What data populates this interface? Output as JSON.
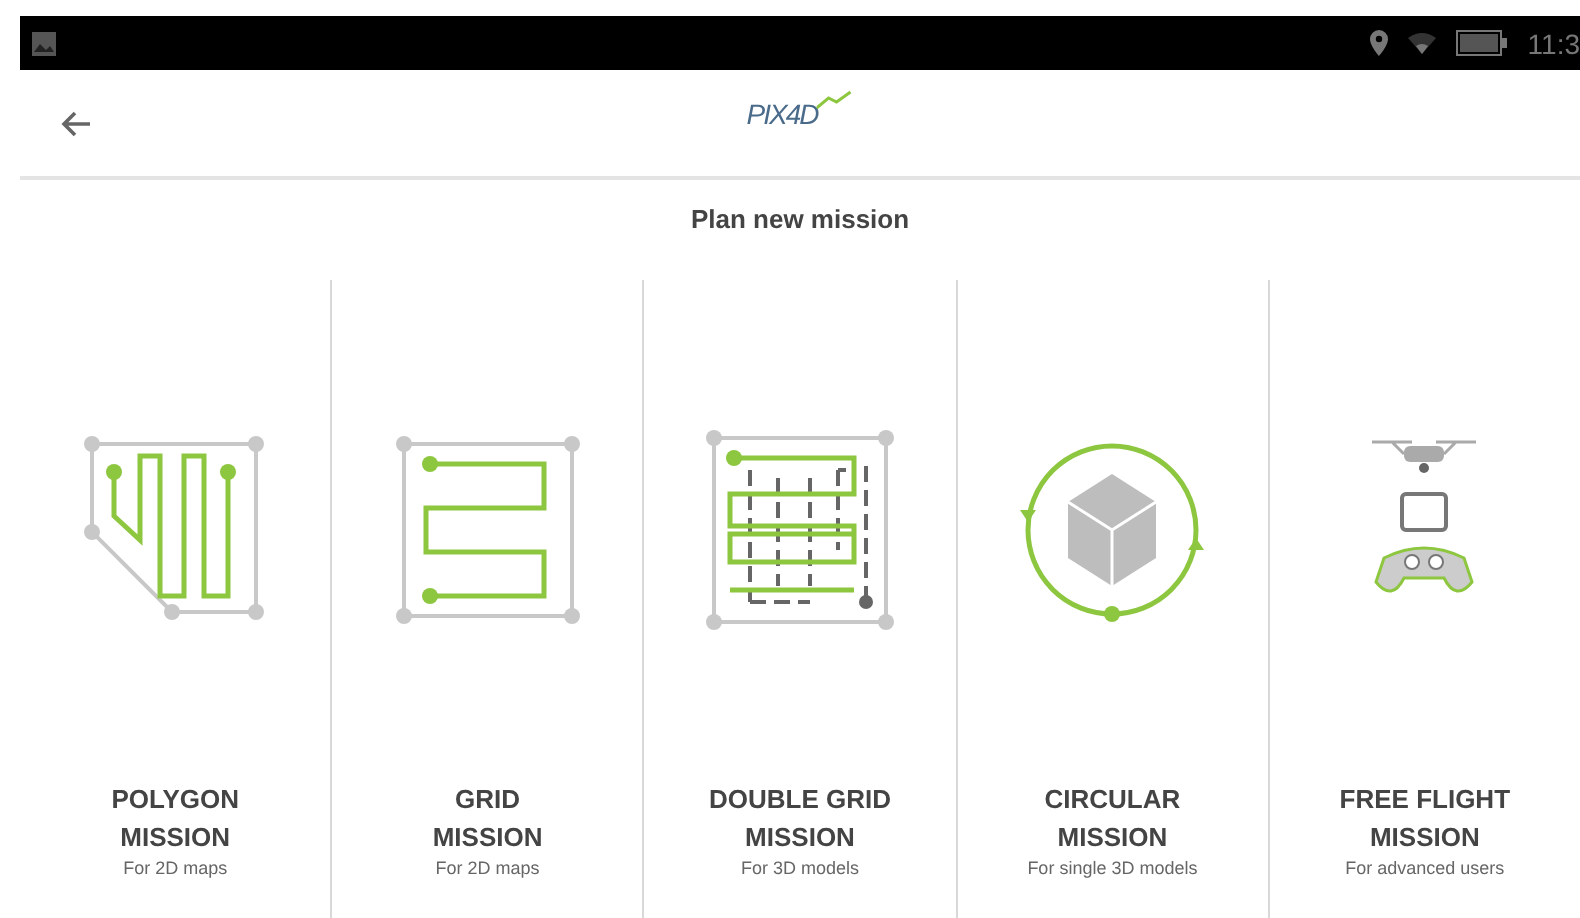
{
  "status_bar": {
    "time": "11:3"
  },
  "app_bar": {
    "logo": "PIX4D"
  },
  "title": "Plan new mission",
  "missions": [
    {
      "kind": "polygon",
      "title": "POLYGON",
      "title2": "MISSION",
      "subtitle": "For 2D maps"
    },
    {
      "kind": "grid",
      "title": "GRID",
      "title2": "MISSION",
      "subtitle": "For 2D maps"
    },
    {
      "kind": "doublegrid",
      "title": "DOUBLE GRID",
      "title2": "MISSION",
      "subtitle": "For 3D models"
    },
    {
      "kind": "circular",
      "title": "CIRCULAR",
      "title2": "MISSION",
      "subtitle": "For single 3D models"
    },
    {
      "kind": "freeflight",
      "title": "FREE FLIGHT",
      "title2": "MISSION",
      "subtitle": "For advanced users"
    }
  ]
}
